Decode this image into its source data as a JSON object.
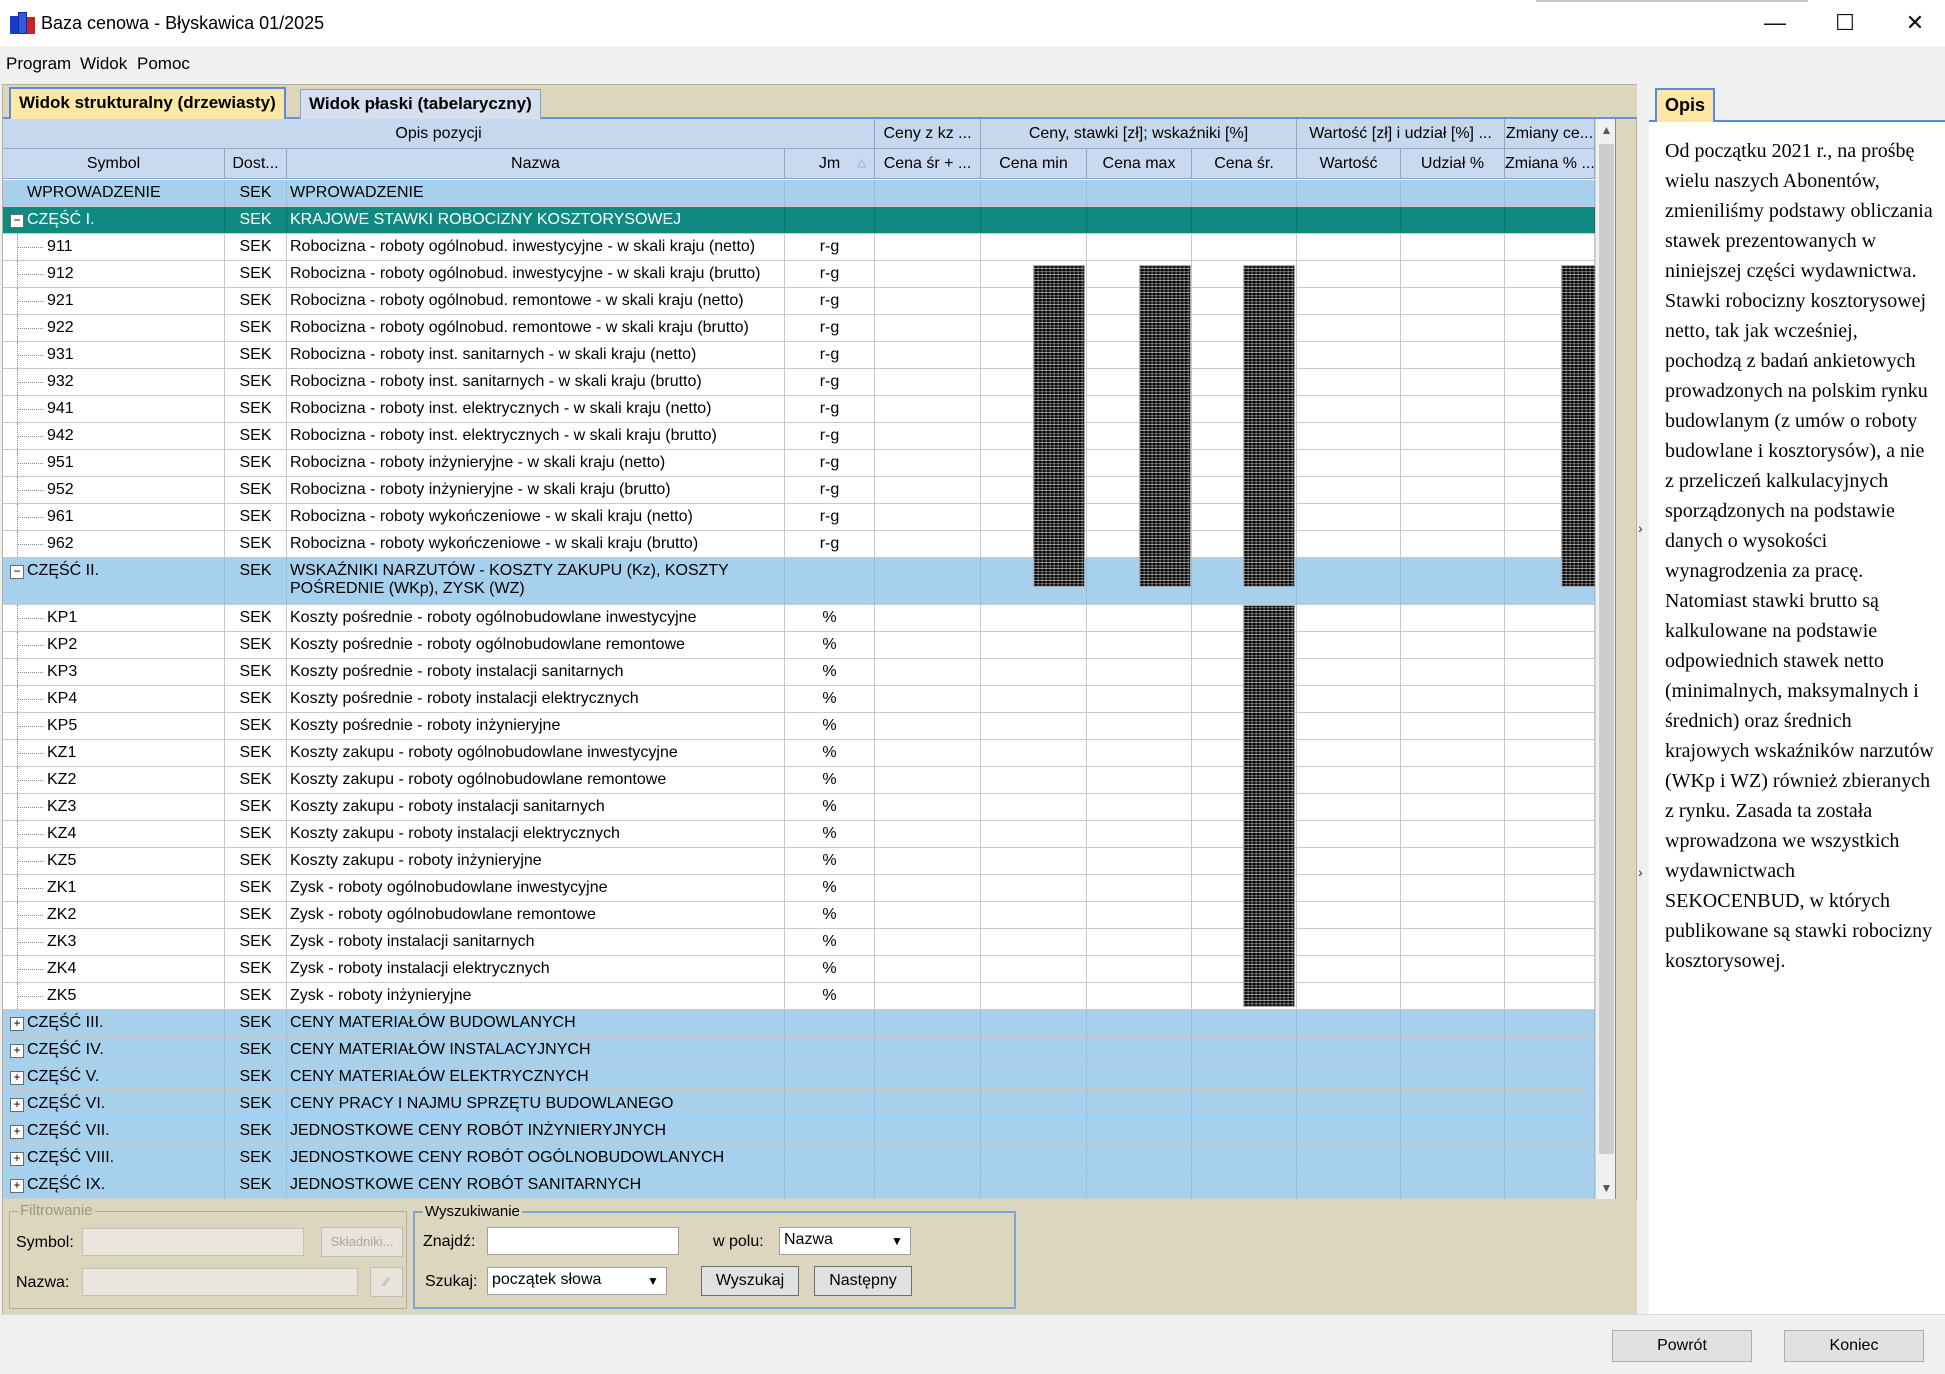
{
  "window": {
    "title": "Baza cenowa - Błyskawica 01/2025",
    "minimize": "—",
    "maximize": "☐",
    "close": "✕"
  },
  "menu": [
    "Program",
    "Widok",
    "Pomoc"
  ],
  "tabs": [
    "Widok strukturalny (drzewiasty)",
    "Widok płaski (tabelaryczny)"
  ],
  "header_groups": [
    "Opis pozycji",
    "Ceny z kz ...",
    "Ceny, stawki [zł]; wskaźniki [%]",
    "Wartość [zł] i udział [%] ...",
    "Zmiany ce..."
  ],
  "columns": [
    "Symbol",
    "Dost...",
    "Nazwa",
    "Jm",
    "Cena śr + ...",
    "Cena min",
    "Cena max",
    "Cena śr.",
    "Wartość",
    "Udział %",
    "Zmiana % ..."
  ],
  "rows": [
    {
      "sym": "WPROWADZENIE",
      "dost": "SEK",
      "name": "WPROWADZENIE",
      "jm": "",
      "type": "sec"
    },
    {
      "sym": "CZĘŚĆ I.",
      "dost": "SEK",
      "name": "KRAJOWE STAWKI ROBOCIZNY KOSZTORYSOWEJ",
      "jm": "",
      "type": "sel",
      "exp": "−"
    },
    {
      "sym": "911",
      "dost": "SEK",
      "name": "Robocizna - roboty ogólnobud. inwestycyjne - w skali kraju (netto)",
      "jm": "r-g",
      "type": "item"
    },
    {
      "sym": "912",
      "dost": "SEK",
      "name": "Robocizna - roboty ogólnobud. inwestycyjne - w skali kraju (brutto)",
      "jm": "r-g",
      "type": "item"
    },
    {
      "sym": "921",
      "dost": "SEK",
      "name": "Robocizna - roboty ogólnobud. remontowe - w skali kraju (netto)",
      "jm": "r-g",
      "type": "item"
    },
    {
      "sym": "922",
      "dost": "SEK",
      "name": "Robocizna - roboty ogólnobud. remontowe - w skali kraju (brutto)",
      "jm": "r-g",
      "type": "item"
    },
    {
      "sym": "931",
      "dost": "SEK",
      "name": "Robocizna - roboty inst. sanitarnych - w skali kraju (netto)",
      "jm": "r-g",
      "type": "item"
    },
    {
      "sym": "932",
      "dost": "SEK",
      "name": "Robocizna - roboty inst. sanitarnych - w skali kraju (brutto)",
      "jm": "r-g",
      "type": "item"
    },
    {
      "sym": "941",
      "dost": "SEK",
      "name": "Robocizna - roboty inst. elektrycznych - w skali kraju (netto)",
      "jm": "r-g",
      "type": "item"
    },
    {
      "sym": "942",
      "dost": "SEK",
      "name": "Robocizna - roboty inst. elektrycznych - w skali kraju (brutto)",
      "jm": "r-g",
      "type": "item"
    },
    {
      "sym": "951",
      "dost": "SEK",
      "name": "Robocizna - roboty inżynieryjne - w skali kraju (netto)",
      "jm": "r-g",
      "type": "item"
    },
    {
      "sym": "952",
      "dost": "SEK",
      "name": "Robocizna - roboty inżynieryjne - w skali kraju (brutto)",
      "jm": "r-g",
      "type": "item"
    },
    {
      "sym": "961",
      "dost": "SEK",
      "name": "Robocizna - roboty wykończeniowe - w skali kraju (netto)",
      "jm": "r-g",
      "type": "item"
    },
    {
      "sym": "962",
      "dost": "SEK",
      "name": "Robocizna - roboty wykończeniowe - w skali kraju (brutto)",
      "jm": "r-g",
      "type": "item"
    },
    {
      "sym": "CZĘŚĆ II.",
      "dost": "SEK",
      "name": "WSKAŹNIKI NARZUTÓW - KOSZTY ZAKUPU (Kz), KOSZTY",
      "name2": "POŚREDNIE (WKp), ZYSK (WZ)",
      "jm": "",
      "type": "sec2",
      "exp": "−"
    },
    {
      "sym": "KP1",
      "dost": "SEK",
      "name": "Koszty pośrednie - roboty ogólnobudowlane inwestycyjne",
      "jm": "%",
      "type": "item"
    },
    {
      "sym": "KP2",
      "dost": "SEK",
      "name": "Koszty pośrednie - roboty ogólnobudowlane remontowe",
      "jm": "%",
      "type": "item"
    },
    {
      "sym": "KP3",
      "dost": "SEK",
      "name": "Koszty pośrednie - roboty instalacji sanitarnych",
      "jm": "%",
      "type": "item"
    },
    {
      "sym": "KP4",
      "dost": "SEK",
      "name": "Koszty pośrednie - roboty instalacji elektrycznych",
      "jm": "%",
      "type": "item"
    },
    {
      "sym": "KP5",
      "dost": "SEK",
      "name": "Koszty pośrednie - roboty inżynieryjne",
      "jm": "%",
      "type": "item"
    },
    {
      "sym": "KZ1",
      "dost": "SEK",
      "name": "Koszty zakupu - roboty ogólnobudowlane inwestycyjne",
      "jm": "%",
      "type": "item"
    },
    {
      "sym": "KZ2",
      "dost": "SEK",
      "name": "Koszty zakupu - roboty ogólnobudowlane remontowe",
      "jm": "%",
      "type": "item"
    },
    {
      "sym": "KZ3",
      "dost": "SEK",
      "name": "Koszty zakupu - roboty instalacji sanitarnych",
      "jm": "%",
      "type": "item"
    },
    {
      "sym": "KZ4",
      "dost": "SEK",
      "name": "Koszty zakupu - roboty instalacji elektrycznych",
      "jm": "%",
      "type": "item"
    },
    {
      "sym": "KZ5",
      "dost": "SEK",
      "name": "Koszty zakupu - roboty inżynieryjne",
      "jm": "%",
      "type": "item"
    },
    {
      "sym": "ZK1",
      "dost": "SEK",
      "name": "Zysk - roboty ogólnobudowlane inwestycyjne",
      "jm": "%",
      "type": "item"
    },
    {
      "sym": "ZK2",
      "dost": "SEK",
      "name": "Zysk - roboty ogólnobudowlane remontowe",
      "jm": "%",
      "type": "item"
    },
    {
      "sym": "ZK3",
      "dost": "SEK",
      "name": "Zysk - roboty instalacji sanitarnych",
      "jm": "%",
      "type": "item"
    },
    {
      "sym": "ZK4",
      "dost": "SEK",
      "name": "Zysk - roboty instalacji elektrycznych",
      "jm": "%",
      "type": "item"
    },
    {
      "sym": "ZK5",
      "dost": "SEK",
      "name": "Zysk - roboty inżynieryjne",
      "jm": "%",
      "type": "item"
    },
    {
      "sym": "CZĘŚĆ III.",
      "dost": "SEK",
      "name": "CENY MATERIAŁÓW BUDOWLANYCH",
      "jm": "",
      "type": "sec",
      "exp": "+"
    },
    {
      "sym": "CZĘŚĆ IV.",
      "dost": "SEK",
      "name": "CENY MATERIAŁÓW INSTALACYJNYCH",
      "jm": "",
      "type": "sec",
      "exp": "+"
    },
    {
      "sym": "CZĘŚĆ V.",
      "dost": "SEK",
      "name": "CENY MATERIAŁÓW ELEKTRYCZNYCH",
      "jm": "",
      "type": "sec",
      "exp": "+"
    },
    {
      "sym": "CZĘŚĆ VI.",
      "dost": "SEK",
      "name": "CENY PRACY I NAJMU SPRZĘTU BUDOWLANEGO",
      "jm": "",
      "type": "sec",
      "exp": "+"
    },
    {
      "sym": "CZĘŚĆ VII.",
      "dost": "SEK",
      "name": "JEDNOSTKOWE CENY ROBÓT INŻYNIERYJNYCH",
      "jm": "",
      "type": "sec",
      "exp": "+"
    },
    {
      "sym": "CZĘŚĆ VIII.",
      "dost": "SEK",
      "name": "JEDNOSTKOWE CENY ROBÓT OGÓLNOBUDOWLANYCH",
      "jm": "",
      "type": "sec",
      "exp": "+"
    },
    {
      "sym": "CZĘŚĆ IX.",
      "dost": "SEK",
      "name": "JEDNOSTKOWE CENY ROBÓT SANITARNYCH",
      "jm": "",
      "type": "sec",
      "exp": "+"
    }
  ],
  "filter": {
    "legend": "Filtrowanie",
    "symbol_label": "Symbol:",
    "nazwa_label": "Nazwa:",
    "skladniki_label": "Składniki...",
    "small_btn": "⁄⁄"
  },
  "search": {
    "legend": "Wyszukiwanie",
    "znajdz_label": "Znajdź:",
    "znajdz_value": "",
    "wpolu_label": "w polu:",
    "wpolu_value": "Nazwa",
    "szukaj_label": "Szukaj:",
    "szukaj_value": "początek słowa",
    "btn_search": "Wyszukaj",
    "btn_next": "Następny"
  },
  "right": {
    "tab": "Opis",
    "text": "Od początku 2021 r., na prośbę wielu naszych Abonentów, zmieniliśmy podstawy obliczania stawek prezentowanych w niniejszej części wydawnictwa. Stawki robocizny kosztorysowej netto, tak jak wcześniej, pochodzą z badań ankietowych prowadzonych na polskim rynku budowlanym (z umów o roboty budowlane i kosztorysów), a nie z przeliczeń kalkulacyjnych sporządzonych na podstawie danych o wysokości wynagrodzenia za pracę. Natomiast stawki brutto są kalkulowane na podstawie odpowiednich stawek netto (minimalnych, maksymalnych i średnich) oraz średnich krajowych wskaźników narzutów (WKp i WZ) również zbieranych z rynku. Zasada ta została wprowadzona we wszystkich wydawnictwach SEKOCENBUD, w których publikowane są stawki robocizny kosztorysowej."
  },
  "bottom": {
    "back": "Powrót",
    "end": "Koniec"
  },
  "colors": {
    "section_row": "#a7d0ec",
    "selected_row": "#0e8a80",
    "active_tab": "#fde7a2",
    "panel_bg": "#dcd6bf"
  }
}
